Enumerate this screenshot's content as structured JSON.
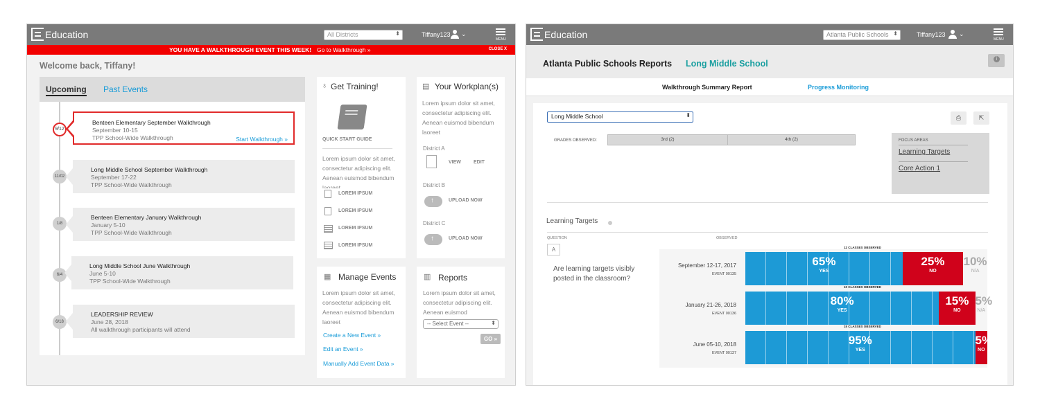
{
  "left": {
    "app_title": "Education",
    "district_select": "All Districts",
    "username": "Tiffany123",
    "menu_label": "MENU",
    "alert": {
      "message": "YOU HAVE A WALKTHROUGH EVENT THIS WEEK!",
      "link": "Go to Walkthrough »",
      "close": "CLOSE X"
    },
    "welcome": "Welcome back, Tiffany!",
    "tabs": {
      "upcoming": "Upcoming",
      "past": "Past Events"
    },
    "events": [
      {
        "badge": "9/12",
        "title": "Benteen Elementary September Walkthrough",
        "dates": "September 10-15",
        "scope": "TPP School-Wide Walkthrough",
        "action": "Start Walkthrough »"
      },
      {
        "badge": "11/02",
        "title": "Long Middle School September Walkthrough",
        "dates": "September 17-22",
        "scope": "TPP School-Wide Walkthrough"
      },
      {
        "badge": "1/8",
        "title": "Benteen Elementary January Walkthrough",
        "dates": "January 5-10",
        "scope": "TPP School-Wide Walkthrough"
      },
      {
        "badge": "6/4",
        "title": "Long Middle School June Walkthrough",
        "dates": "June 5-10",
        "scope": "TPP School-Wide Walkthrough"
      },
      {
        "badge": "6/18",
        "title": "LEADERSHIP REVIEW",
        "dates": "June 28, 2018",
        "scope": "All walkthrough participants will attend"
      }
    ],
    "training": {
      "title": "Get Training!",
      "guide_label": "QUICK START GUIDE",
      "lorem": "Lorem ipsum dolor sit amet, consectetur adipiscing elit. Aenean euismod bibendum laoreet",
      "items": [
        "LOREM IPSUM",
        "LOREM IPSUM",
        "LOREM IPSUM",
        "LOREM IPSUM"
      ]
    },
    "workplan": {
      "title": "Your Workplan(s)",
      "lorem": "Lorem ipsum dolor sit amet, consectetur adipiscing elit. Aenean euismod bibendum laoreet",
      "districts": [
        {
          "name": "District A",
          "view": "VIEW",
          "edit": "EDIT"
        },
        {
          "name": "District B",
          "upload": "UPLOAD NOW"
        },
        {
          "name": "District C",
          "upload": "UPLOAD NOW"
        }
      ]
    },
    "manage": {
      "title": "Manage Events",
      "lorem": "Lorem ipsum dolor sit amet, consectetur adipiscing elit. Aenean euismod bibendum laoreet",
      "links": [
        "Create a New Event »",
        "Edit an Event »",
        "Manually Add Event Data »"
      ]
    },
    "reports": {
      "title": "Reports",
      "lorem": "Lorem ipsum dolor sit amet, consectetur adipiscing elit. Aenean euismod",
      "select": "-- Select Event --",
      "go": "GO »"
    }
  },
  "right": {
    "app_title": "Education",
    "district_select": "Atlanta Public Schools",
    "username": "Tiffany123",
    "menu_label": "MENU",
    "report_title": "Atlanta Public Schools Reports",
    "school_title": "Long Middle School",
    "subnav": {
      "summary": "Walkthrough Summary Report",
      "progress": "Progress Monitoring"
    },
    "school_select": "Long Middle School",
    "grades_label": "GRADES OBSERVED:",
    "grades": [
      "3rd (2)",
      "4th (2)"
    ],
    "focus": {
      "heading": "FOCUS AREAS",
      "items": [
        "Learning Targets",
        "Core Action 1"
      ]
    },
    "section_title": "Learning Targets",
    "col_question": "QUESTION",
    "col_observed": "OBSERVED",
    "question_letter": "A",
    "question_text": "Are learning targets visibly posted in the classroom?",
    "rows": [
      {
        "date": "September 12-17, 2017",
        "event": "EVENT 00135",
        "classes": "12 CLASSES OBSERVED",
        "yes": 65,
        "yes_label": "65%",
        "yes_text": "YES",
        "no": 25,
        "no_label": "25%",
        "no_text": "NO",
        "na": 10,
        "na_label": "10%",
        "na_text": "N/A"
      },
      {
        "date": "January 21-26, 2018",
        "event": "EVENT 00136",
        "classes": "10 CLASSES OBSERVED",
        "yes": 80,
        "yes_label": "80%",
        "yes_text": "YES",
        "no": 15,
        "no_label": "15%",
        "no_text": "NO",
        "na": 5,
        "na_label": "5%",
        "na_text": "N/A"
      },
      {
        "date": "June 05-10, 2018",
        "event": "EVENT 00137",
        "classes": "15 CLASSES OBSERVED",
        "yes": 95,
        "yes_label": "95%",
        "yes_text": "YES",
        "no": 5,
        "no_label": "5%",
        "no_text": "NO",
        "na": 0,
        "na_label": "",
        "na_text": ""
      }
    ]
  },
  "colors": {
    "yes": "#1d9ad6",
    "no": "#d0021b",
    "alert": "#f20000",
    "link": "#1a9cd8",
    "teal": "#1a9fa0"
  }
}
